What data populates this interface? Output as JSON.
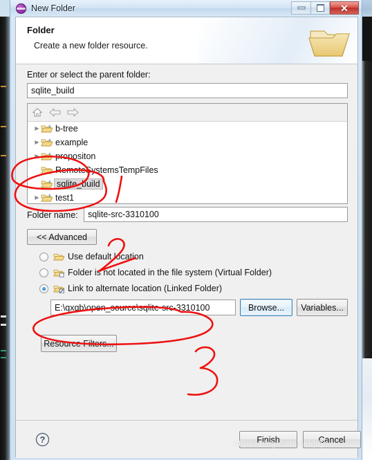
{
  "window": {
    "title": "New Folder",
    "app_icon": "eclipse-sphere-icon",
    "buttons": {
      "minimize": "minimize-icon",
      "maximize": "maximize-icon",
      "close": "✕"
    }
  },
  "header": {
    "title": "Folder",
    "description": "Create a new folder resource.",
    "banner_icon": "folder-banner-icon"
  },
  "content": {
    "parent_label": "Enter or select the parent folder:",
    "parent_value": "sqlite_build",
    "parent_placeholder": "",
    "tree_toolbar": [
      {
        "name": "home-icon",
        "glyph": "home"
      },
      {
        "name": "back-arrow-icon",
        "glyph": "back"
      },
      {
        "name": "forward-arrow-icon",
        "glyph": "forward"
      }
    ],
    "tree_items": [
      {
        "label": "b-tree",
        "expandable": true,
        "selected": false,
        "icon": "project-folder-icon"
      },
      {
        "label": "example",
        "expandable": true,
        "selected": false,
        "icon": "project-folder-icon"
      },
      {
        "label": "propositon",
        "expandable": true,
        "selected": false,
        "icon": "project-folder-icon"
      },
      {
        "label": "RemoteSystemsTempFiles",
        "expandable": false,
        "selected": false,
        "icon": "folder-icon"
      },
      {
        "label": "sqlite_build",
        "expandable": false,
        "selected": true,
        "icon": "project-folder-icon"
      },
      {
        "label": "test1",
        "expandable": true,
        "selected": false,
        "icon": "project-folder-icon"
      }
    ],
    "folder_name_label": "Folder name:",
    "folder_name_value": "sqlite-src-3310100",
    "advanced_label": "<< Advanced",
    "options": [
      {
        "label": "Use default location",
        "checked": false,
        "icon": "folder-default-icon"
      },
      {
        "label": "Folder is not located in the file system (Virtual Folder)",
        "checked": false,
        "icon": "folder-virtual-icon"
      },
      {
        "label": "Link to alternate location (Linked Folder)",
        "checked": true,
        "icon": "folder-linked-icon"
      }
    ],
    "location_value": "E:\\qxqb\\open_source\\sqlite-src-3310100",
    "browse_label": "Browse...",
    "variables_label": "Variables...",
    "resource_filters_label": "Resource Filters..."
  },
  "footer": {
    "help_icon": "help-question-icon",
    "finish_label": "Finish",
    "cancel_label": "Cancel"
  },
  "annotations": {
    "color": "#ee1111",
    "marks": [
      {
        "name": "annotation-circle-tree",
        "type": "ellipse",
        "label": ""
      },
      {
        "name": "annotation-number-1",
        "type": "stroke",
        "label": "1"
      },
      {
        "name": "annotation-circle-advanced",
        "type": "ellipse",
        "label": ""
      },
      {
        "name": "annotation-number-2",
        "type": "stroke",
        "label": "2"
      },
      {
        "name": "annotation-circle-location",
        "type": "ellipse",
        "label": ""
      },
      {
        "name": "annotation-number-3",
        "type": "stroke",
        "label": "3"
      }
    ]
  },
  "watermark": {
    "text": "https://blog.csdn.net/pfysw"
  }
}
